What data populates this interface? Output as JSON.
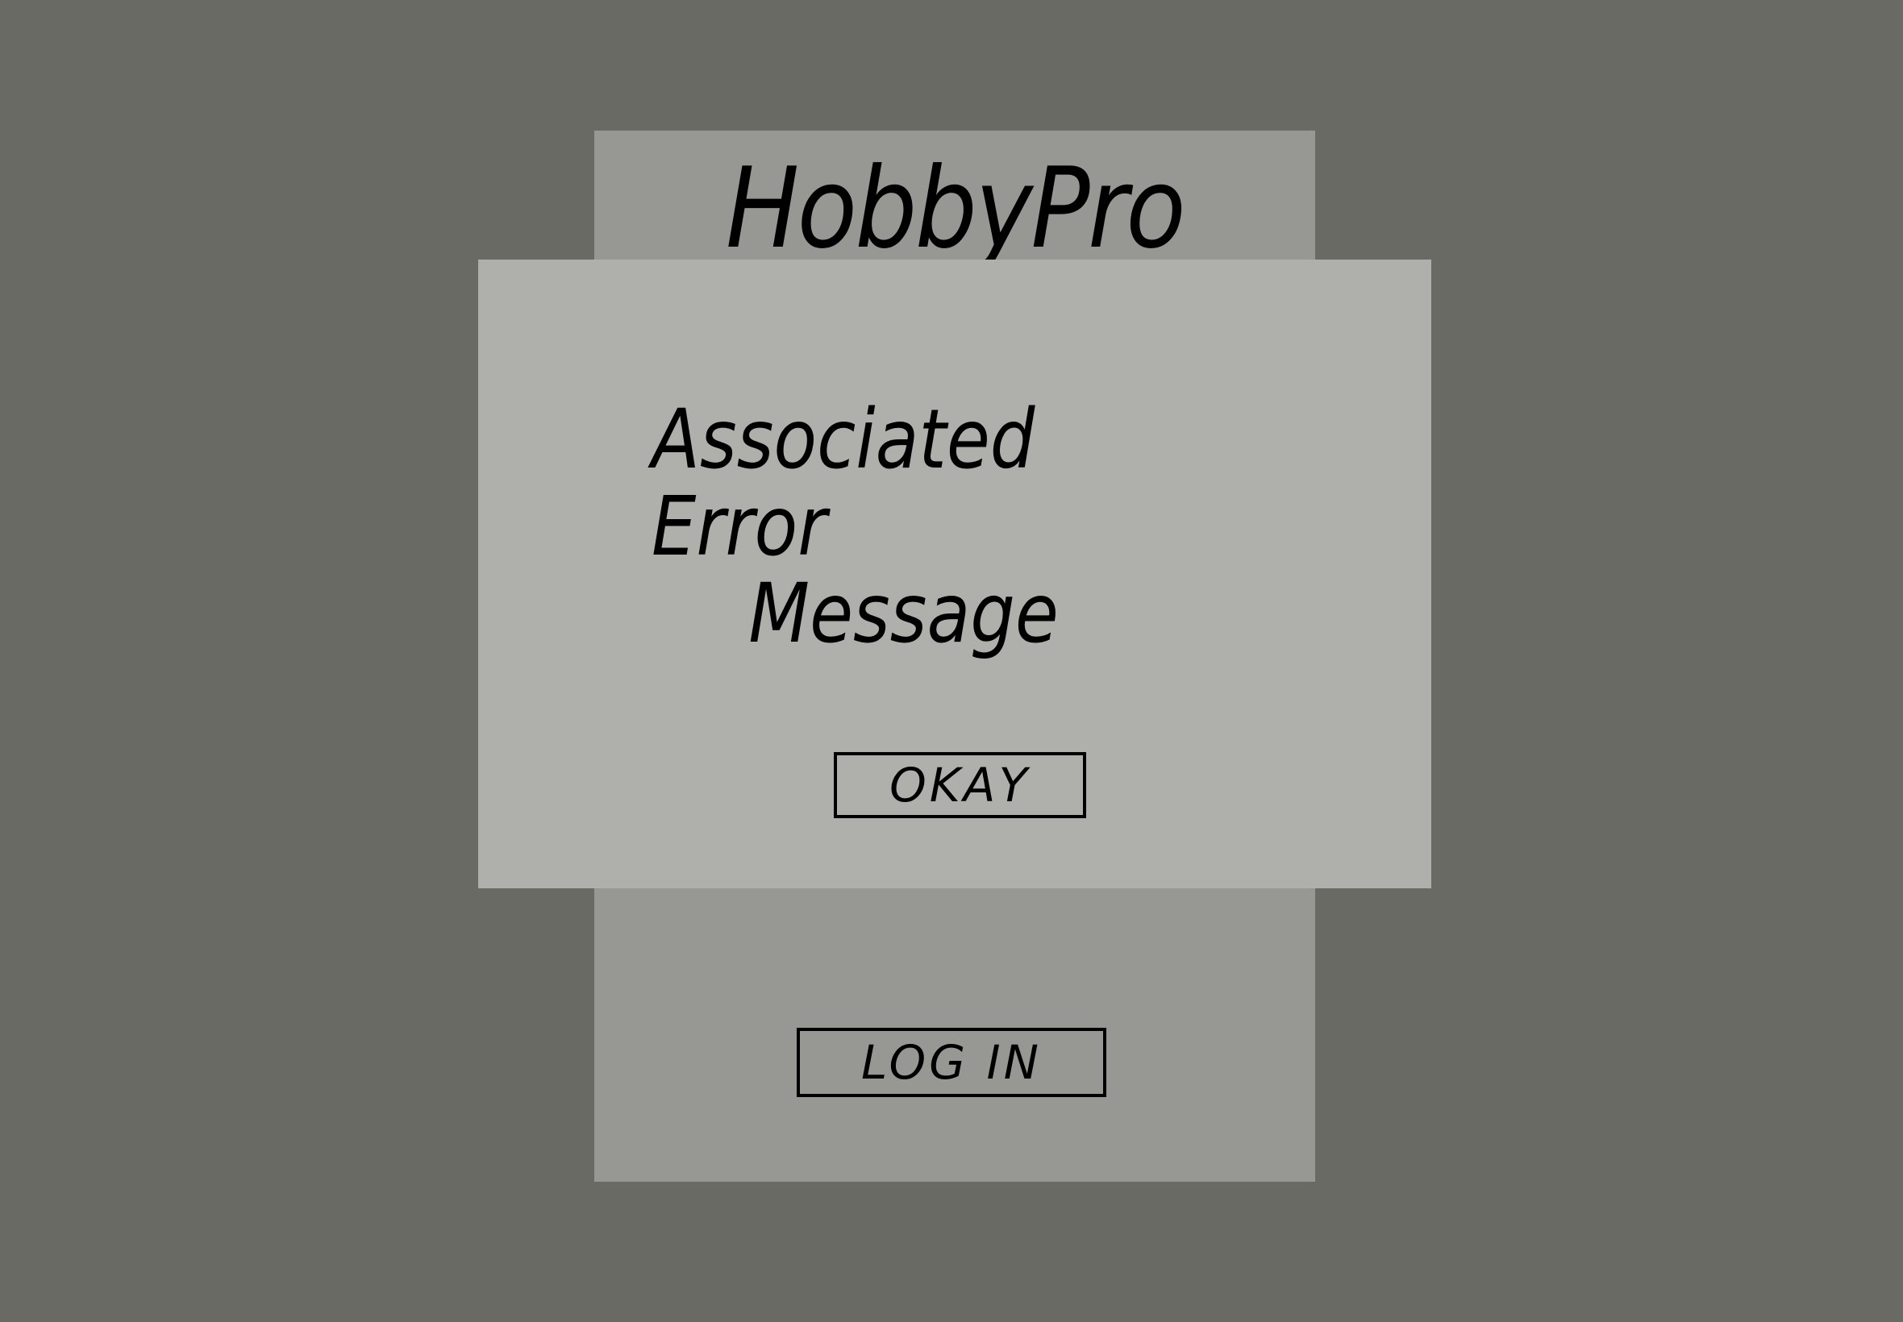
{
  "app": {
    "title": "HobbyPro"
  },
  "login": {
    "button_label": "LOG IN"
  },
  "modal": {
    "message_line1": "Associated Error",
    "message_line2": "Message",
    "ok_label": "OKAY"
  },
  "colors": {
    "backdrop": "#696a64",
    "card": "#979893",
    "modal": "#afb0ab"
  }
}
